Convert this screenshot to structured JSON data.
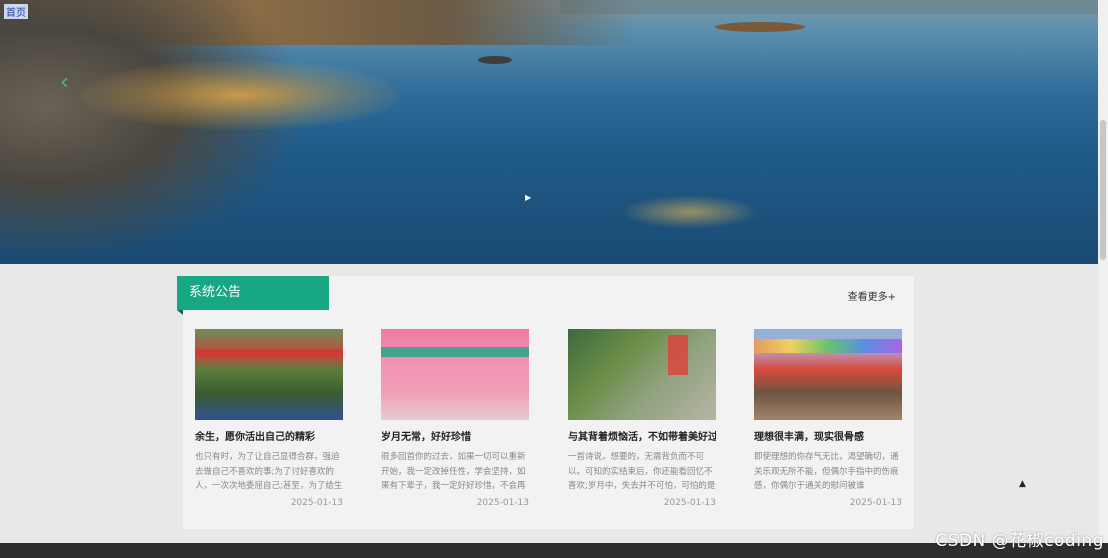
{
  "top_link": "首页",
  "section": {
    "title": "系统公告",
    "more_label": "查看更多+"
  },
  "cards": [
    {
      "title": "余生，愿你活出自己的精彩",
      "desc": "也只有时，为了让自己显得合群，强迫去做自己不喜欢的事;为了讨好喜欢的人，一次次地委屈自己;甚至，为了给生",
      "date": "2025-01-13"
    },
    {
      "title": "岁月无常，好好珍惜",
      "desc": "很多回首你的过去，如果一切可以重新开始，我一定改掉任性，学会坚持，如果有下辈子，我一定好好珍惜，不会再养",
      "date": "2025-01-13"
    },
    {
      "title": "与其背着烦恼活，不如带着美好过",
      "desc": "一首诗说，想要的，无需背负而不可以。可知的实结束后，你还能看回忆不喜欢;岁月中，失去并不可怕，可怕的是",
      "date": "2025-01-13"
    },
    {
      "title": "理想很丰满，现实很骨感",
      "desc": "即使理想的你存气无比，渴望确切，通关乐观无所不能，但偶尔手指中的伤痕感，你偶尔于通关的慰问被谁",
      "date": "2025-01-13"
    }
  ],
  "watermark": "CSDN @花椒coding",
  "icons": {
    "carousel_prev": "chevron-left-icon",
    "back_to_top": "arrow-up-icon"
  }
}
